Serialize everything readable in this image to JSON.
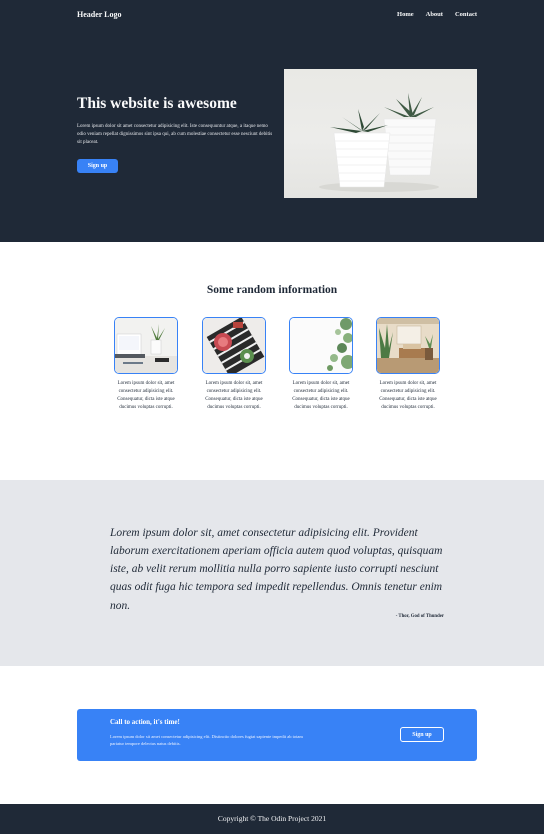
{
  "header": {
    "logo": "Header Logo",
    "nav": [
      "Home",
      "About",
      "Contact"
    ]
  },
  "hero": {
    "title": "This website is awesome",
    "text": "Lorem ipsum dolor sit amet consectetur adipisicing elit. Iste consequuntur atque, a itaque nemo odio veniam repellat dignissimos sint ipsa qui, ab cum molestiae consectetur esse nesciunt debitis sit placeat.",
    "button": "Sign up",
    "image_name": "succulent-pots-image"
  },
  "info": {
    "title": "Some random information",
    "cards": [
      {
        "text": "Lorem ipsum dolor sit, amet consectetur adipisicing elit. Consequatur, dicta iste atque ducimus voluptas corrupti.",
        "image_name": "desk-laptop-image"
      },
      {
        "text": "Lorem ipsum dolor sit, amet consectetur adipisicing elit. Consequatur, dicta iste atque ducimus voluptas corrupti.",
        "image_name": "flower-tray-image"
      },
      {
        "text": "Lorem ipsum dolor sit, amet consectetur adipisicing elit. Consequatur, dicta iste atque ducimus voluptas corrupti.",
        "image_name": "succulents-image"
      },
      {
        "text": "Lorem ipsum dolor sit, amet consectetur adipisicing elit. Consequatur, dicta iste atque ducimus voluptas corrupti.",
        "image_name": "living-room-image"
      }
    ]
  },
  "quote": {
    "text": "Lorem ipsum dolor sit, amet consectetur adipisicing elit. Provident laborum exercitationem aperiam officia autem quod voluptas, quisquam iste, ab velit rerum mollitia nulla porro sapiente iusto corrupti nesciunt quas odit fuga hic tempora sed impedit repellendus. Omnis tenetur enim non.",
    "attribution": "- Thor, God of Thunder"
  },
  "cta": {
    "title": "Call to action, it's time!",
    "text": "Lorem ipsum dolor sit amet consectetur adipisicing elit. Distinctio dolores fugiat sapiente impedit ab totam pariatur tempore delectus natus debitis.",
    "button": "Sign up"
  },
  "footer": {
    "text": "Copyright © The Odin Project 2021"
  },
  "colors": {
    "dark": "#1f2937",
    "accent": "#3882f6",
    "light_gray": "#e5e7eb"
  }
}
